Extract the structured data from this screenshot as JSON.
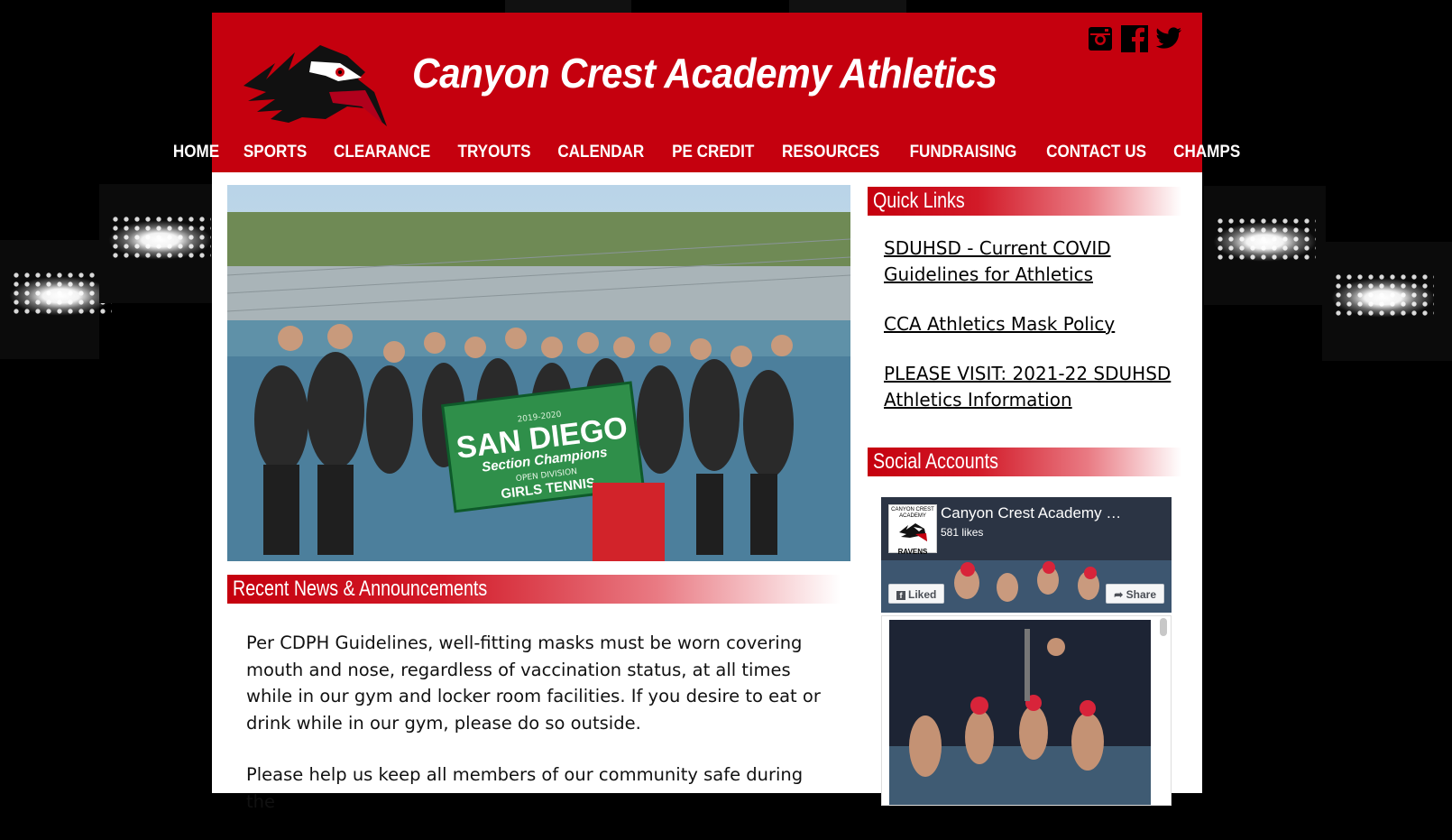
{
  "site": {
    "title": "Canyon Crest Academy Athletics",
    "colors": {
      "brand_red": "#c5000e",
      "background": "#000000",
      "text": "#111111"
    }
  },
  "social_icons": [
    "instagram-icon",
    "facebook-icon",
    "twitter-icon"
  ],
  "nav": {
    "items": [
      "HOME",
      "SPORTS",
      "CLEARANCE",
      "TRYOUTS",
      "CALENDAR",
      "PE CREDIT",
      "RESOURCES",
      "FUNDRAISING",
      "CONTACT US",
      "CHAMPS"
    ]
  },
  "hero": {
    "banner_line1": "SAN DIEGO",
    "banner_line2": "Section Champions",
    "banner_line3": "OPEN DIVISION",
    "banner_line4": "GIRLS TENNIS",
    "banner_year": "2019-2020"
  },
  "news": {
    "heading": "Recent News & Announcements",
    "paragraphs": [
      "Per CDPH Guidelines, well-fitting masks must be worn covering mouth and nose, regardless of vaccination status, at all times while in our gym and locker room facilities. If you desire to eat or drink while in our gym, please do so outside.",
      "Please help us keep all members of our community safe during the"
    ]
  },
  "quick_links": {
    "heading": "Quick Links",
    "links": [
      "SDUHSD - Current COVID Guidelines for Athletics",
      "CCA Athletics Mask Policy",
      "PLEASE VISIT: 2021-22 SDUHSD Athletics Information"
    ]
  },
  "social_accounts": {
    "heading": "Social Accounts",
    "page_name": "Canyon Crest Academy …",
    "likes": "581 likes",
    "liked_button": "Liked",
    "share_button": "Share",
    "avatar_top": "CANYON CREST ACADEMY",
    "avatar_bottom": "RAVENS"
  }
}
